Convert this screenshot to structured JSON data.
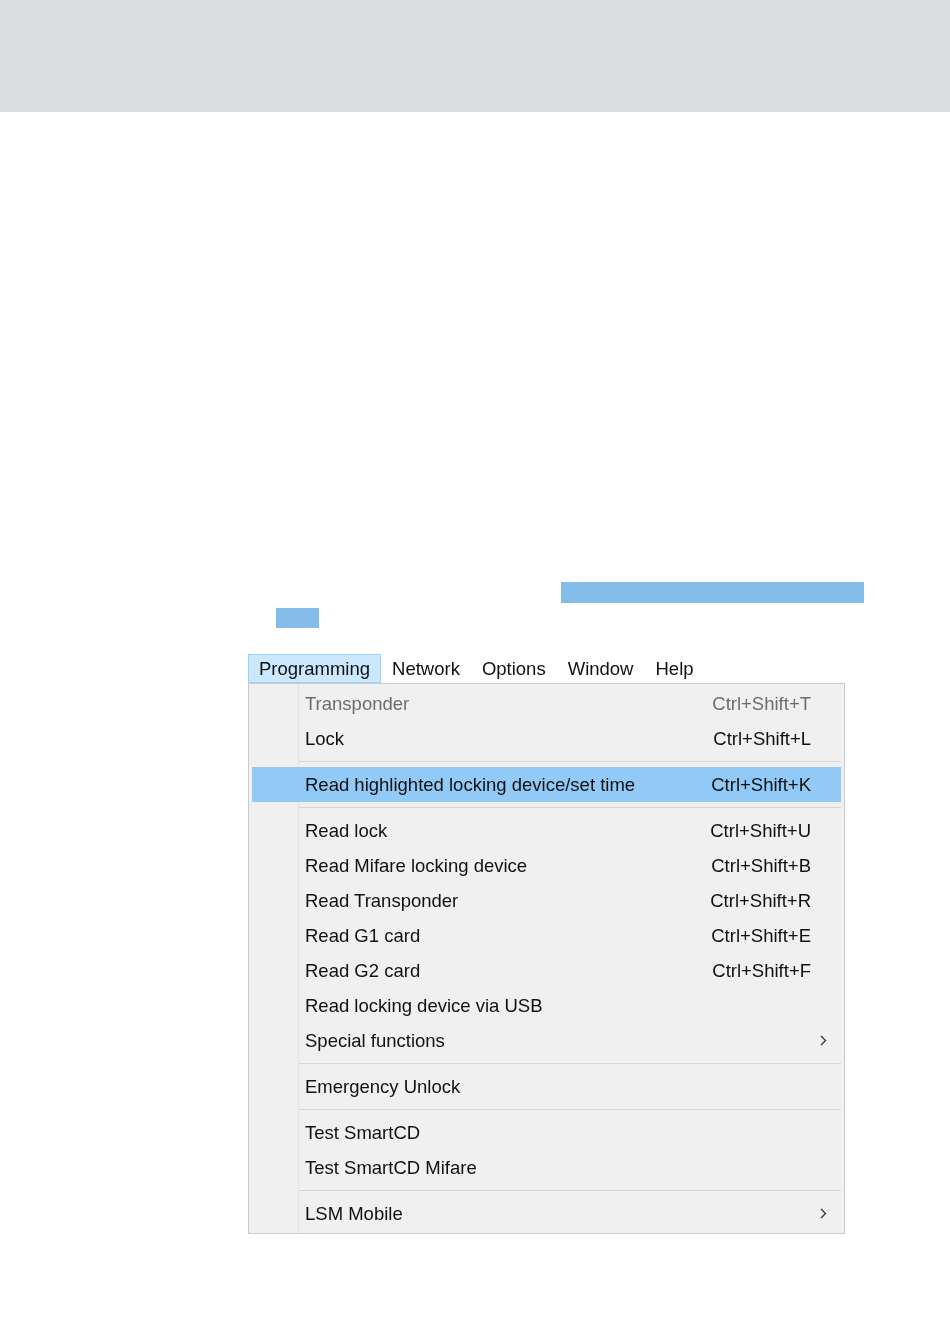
{
  "menubar": [
    {
      "label": "Programming",
      "selected": true
    },
    {
      "label": "Network",
      "selected": false
    },
    {
      "label": "Options",
      "selected": false
    },
    {
      "label": "Window",
      "selected": false
    },
    {
      "label": "Help",
      "selected": false
    }
  ],
  "menu": [
    {
      "kind": "item",
      "label": "Transponder",
      "shortcut": "Ctrl+Shift+T",
      "disabled": true,
      "selected": false
    },
    {
      "kind": "item",
      "label": "Lock",
      "shortcut": "Ctrl+Shift+L",
      "disabled": false,
      "selected": false
    },
    {
      "kind": "separator"
    },
    {
      "kind": "item",
      "label": "Read highlighted locking device/set time",
      "shortcut": "Ctrl+Shift+K",
      "disabled": false,
      "selected": true
    },
    {
      "kind": "separator"
    },
    {
      "kind": "item",
      "label": "Read lock",
      "shortcut": "Ctrl+Shift+U",
      "disabled": false,
      "selected": false
    },
    {
      "kind": "item",
      "label": "Read Mifare locking device",
      "shortcut": "Ctrl+Shift+B",
      "disabled": false,
      "selected": false
    },
    {
      "kind": "item",
      "label": "Read Transponder",
      "shortcut": "Ctrl+Shift+R",
      "disabled": false,
      "selected": false
    },
    {
      "kind": "item",
      "label": "Read G1 card",
      "shortcut": "Ctrl+Shift+E",
      "disabled": false,
      "selected": false
    },
    {
      "kind": "item",
      "label": "Read G2 card",
      "shortcut": "Ctrl+Shift+F",
      "disabled": false,
      "selected": false
    },
    {
      "kind": "item",
      "label": "Read locking device via USB",
      "disabled": false,
      "selected": false
    },
    {
      "kind": "item",
      "label": "Special functions",
      "submenu": true,
      "disabled": false,
      "selected": false
    },
    {
      "kind": "separator"
    },
    {
      "kind": "item",
      "label": "Emergency Unlock",
      "disabled": false,
      "selected": false
    },
    {
      "kind": "separator"
    },
    {
      "kind": "item",
      "label": "Test SmartCD",
      "disabled": false,
      "selected": false
    },
    {
      "kind": "item",
      "label": "Test SmartCD Mifare",
      "disabled": false,
      "selected": false
    },
    {
      "kind": "separator"
    },
    {
      "kind": "item",
      "label": "LSM Mobile",
      "submenu": true,
      "disabled": false,
      "selected": false
    }
  ]
}
